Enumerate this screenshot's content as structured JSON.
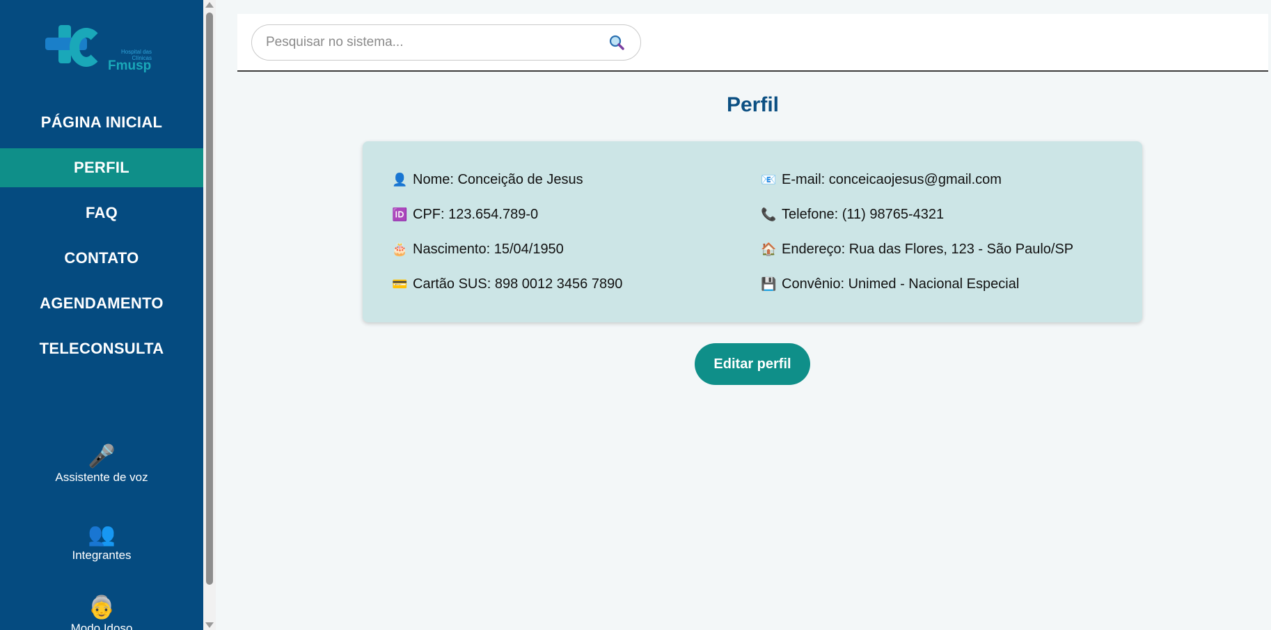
{
  "logo": {
    "small_text": "Hospital das Clínicas",
    "brand": "Fmusp"
  },
  "nav": {
    "items": [
      {
        "label": "PÁGINA INICIAL"
      },
      {
        "label": "PERFIL"
      },
      {
        "label": "FAQ"
      },
      {
        "label": "CONTATO"
      },
      {
        "label": "AGENDAMENTO"
      },
      {
        "label": "TELECONSULTA"
      }
    ],
    "active": "PERFIL"
  },
  "tools": {
    "voice": {
      "icon": "microphone-icon",
      "label": "Assistente de voz"
    },
    "members": {
      "icon": "people-icon",
      "label": "Integrantes"
    },
    "elder": {
      "icon": "elderly-person-icon",
      "label": "Modo Idoso"
    }
  },
  "search": {
    "placeholder": "Pesquisar no sistema...",
    "value": ""
  },
  "page": {
    "title": "Perfil"
  },
  "profile": {
    "name": "Nome: Conceição de Jesus",
    "cpf": "CPF: 123.654.789-0",
    "birth": "Nascimento: 15/04/1950",
    "sus": "Cartão SUS: 898 0012 3456 7890",
    "email": "E-mail: conceicaojesus@gmail.com",
    "phone": "Telefone: (11) 98765-4321",
    "address": "Endereço: Rua das Flores, 123 - São Paulo/SP",
    "insurance": "Convênio: Unimed - Nacional Especial"
  },
  "actions": {
    "edit_label": "Editar perfil"
  },
  "colors": {
    "sidebar": "#054b80",
    "accent": "#0f8f89",
    "card": "#cce5e6",
    "title": "#0b4f82"
  }
}
